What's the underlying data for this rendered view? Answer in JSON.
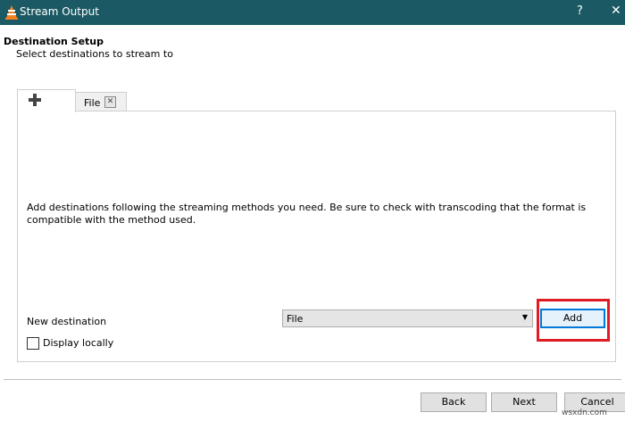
{
  "window": {
    "title": "Stream Output",
    "help_glyph": "?",
    "close_glyph": "✕"
  },
  "header": {
    "title": "Destination Setup",
    "subtitle": "Select destinations to stream to"
  },
  "tabs": {
    "add_icon": "plus-icon",
    "file_label": "File",
    "file_close_glyph": "✕"
  },
  "panel": {
    "description": "Add destinations following the streaming methods you need. Be sure to check with transcoding that the format is compatible with the method used.",
    "new_destination_label": "New destination",
    "destination_value": "File",
    "dropdown_arrow": "▼",
    "add_label": "Add",
    "display_locally_label": "Display locally",
    "display_locally_checked": false
  },
  "footer": {
    "back_label": "Back",
    "next_label": "Next",
    "cancel_label": "Cancel"
  },
  "watermark": "wsxdn.com",
  "colors": {
    "titlebar": "#1b5a64",
    "highlight": "#e01b24",
    "focus": "#0078d7"
  }
}
